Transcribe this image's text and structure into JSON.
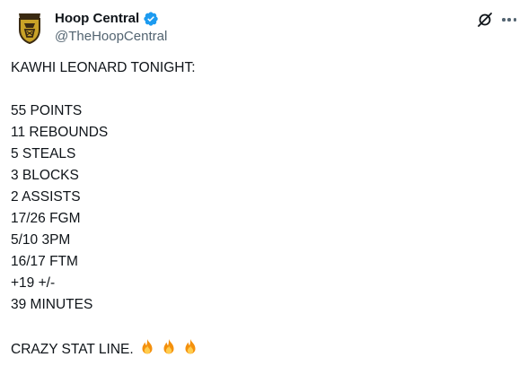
{
  "author": {
    "display_name": "Hoop Central",
    "handle": "@TheHoopCentral",
    "verified": true,
    "verified_color": "#1d9bf0"
  },
  "post": {
    "headline": "KAWHI LEONARD TONIGHT:",
    "stats": [
      "55 POINTS",
      "11 REBOUNDS",
      "5 STEALS",
      "3 BLOCKS",
      "2 ASSISTS",
      "17/26 FGM",
      "5/10 3PM",
      "16/17 FTM",
      "+19 +/-",
      "39 MINUTES"
    ],
    "closing": "CRAZY STAT LINE.",
    "closing_emoji": [
      "fire-icon",
      "fire-icon",
      "fire-icon"
    ]
  },
  "icons": {
    "avatar": "hoop-central-logo",
    "grok": "grok-icon",
    "more": "more-options-icon"
  },
  "colors": {
    "text": "#0f1419",
    "secondary": "#536471",
    "logo_gold": "#c9a227",
    "logo_dark": "#3a2a12"
  }
}
